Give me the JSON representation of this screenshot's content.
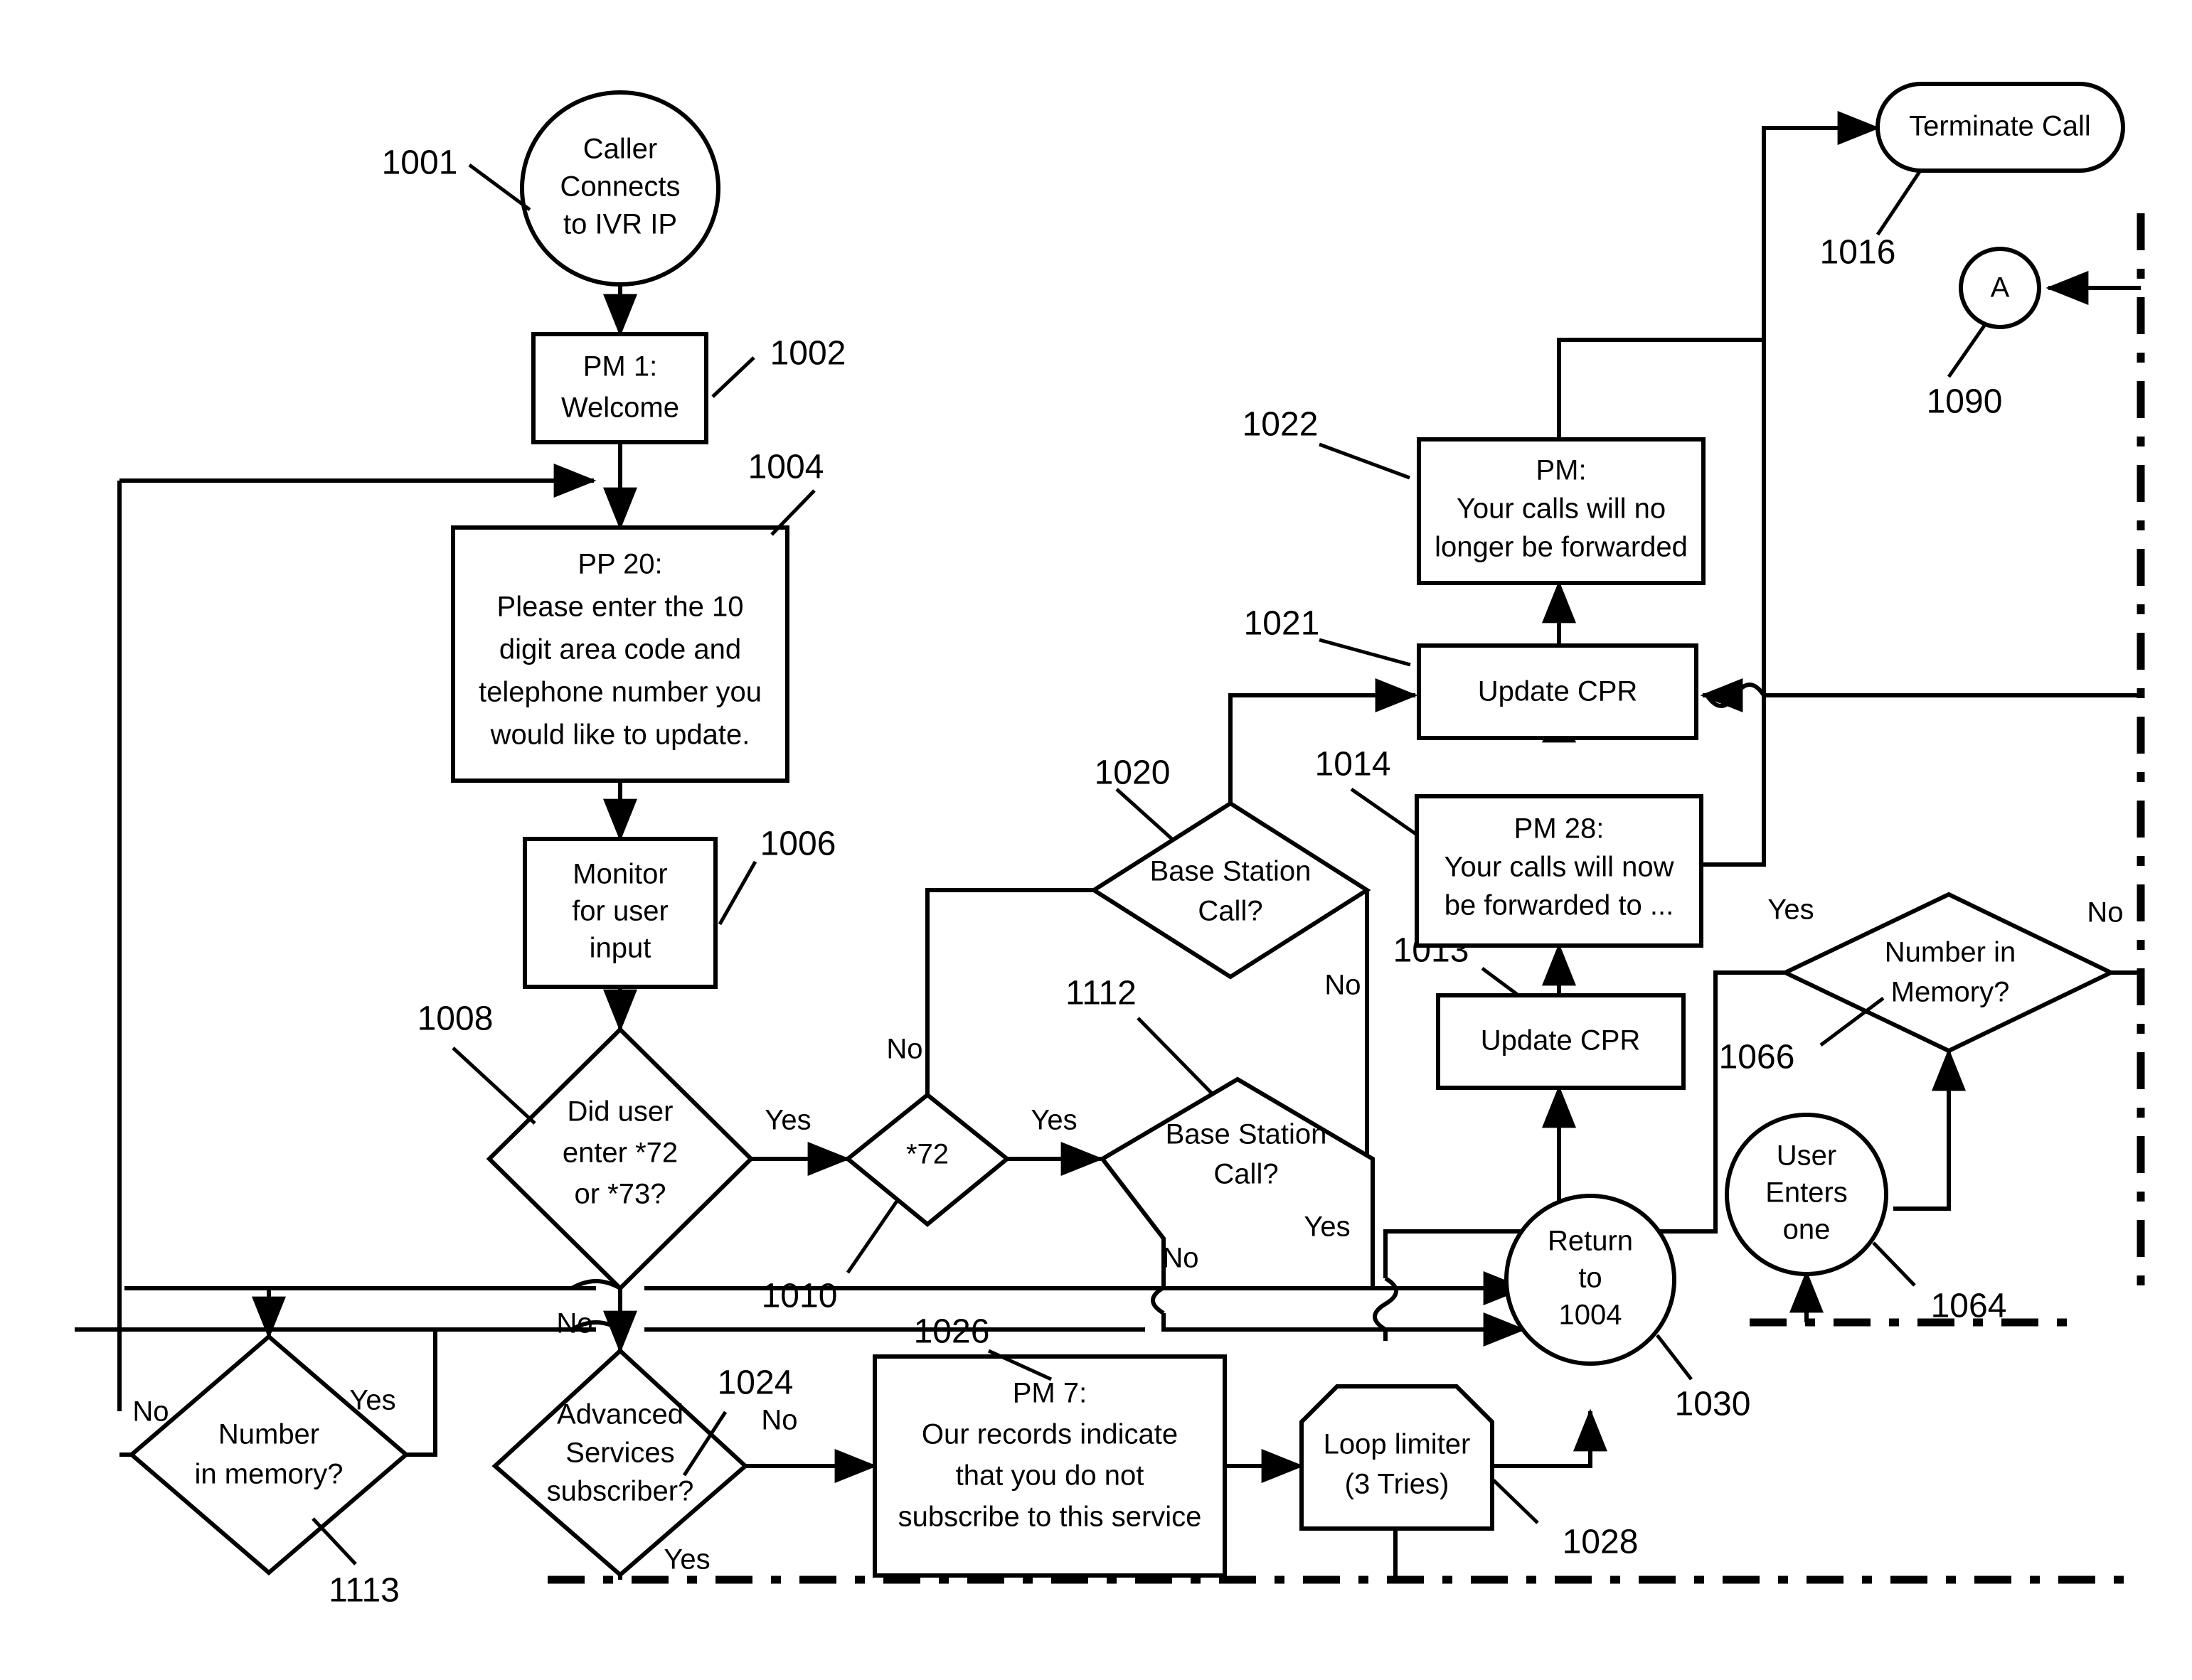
{
  "figure": {
    "type": "patent-flowchart",
    "title": "IVR call-forwarding update flowchart",
    "background": "#ffffff",
    "line_color": "#000000"
  },
  "nodes": {
    "n1001": {
      "ref": "1001",
      "shape": "ellipse",
      "lines": [
        "Caller",
        "Connects",
        "to IVR IP"
      ]
    },
    "n1002": {
      "ref": "1002",
      "shape": "rect",
      "lines": [
        "PM 1:",
        "Welcome"
      ]
    },
    "n1004": {
      "ref": "1004",
      "shape": "rect",
      "lines": [
        "PP 20:",
        "Please enter the 10",
        "digit area code and",
        "telephone number you",
        "would like to update."
      ]
    },
    "n1006": {
      "ref": "1006",
      "shape": "rect",
      "lines": [
        "Monitor",
        "for user",
        "input"
      ]
    },
    "n1008": {
      "ref": "1008",
      "shape": "diamond",
      "lines": [
        "Did user",
        "enter *72",
        "or *73?"
      ]
    },
    "n1010": {
      "ref": "1010",
      "shape": "diamond",
      "lines": [
        "*72"
      ]
    },
    "n1112": {
      "ref": "1112",
      "shape": "diamond",
      "lines": [
        "Base Station",
        "Call?"
      ]
    },
    "n1020": {
      "ref": "1020",
      "shape": "diamond",
      "lines": [
        "Base Station",
        "Call?"
      ]
    },
    "n1013": {
      "ref": "1013",
      "shape": "rect",
      "lines": [
        "Update CPR"
      ]
    },
    "n1014": {
      "ref": "1014",
      "shape": "rect",
      "lines": [
        "PM 28:",
        "Your calls will now",
        "be forwarded to ..."
      ]
    },
    "n1021": {
      "ref": "1021",
      "shape": "rect",
      "lines": [
        "Update CPR"
      ]
    },
    "n1022": {
      "ref": "1022",
      "shape": "rect",
      "lines": [
        "PM:",
        "Your calls will no",
        "longer be forwarded"
      ]
    },
    "n1016": {
      "ref": "1016",
      "shape": "stadium",
      "lines": [
        "Terminate Call"
      ]
    },
    "n1090": {
      "ref": "1090",
      "shape": "circle",
      "lines": [
        "A"
      ]
    },
    "n1030": {
      "ref": "1030",
      "shape": "ellipse",
      "lines": [
        "Return",
        "to",
        "1004"
      ]
    },
    "n1113": {
      "ref": "1113",
      "shape": "diamond",
      "lines": [
        "Number",
        "in memory?"
      ]
    },
    "n1024": {
      "ref": "1024",
      "shape": "diamond",
      "lines": [
        "Advanced",
        "Services",
        "subscriber?"
      ]
    },
    "n1026": {
      "ref": "1026",
      "shape": "rect",
      "lines": [
        "PM 7:",
        "Our records indicate",
        "that you do not",
        "subscribe to this service"
      ]
    },
    "n1028": {
      "ref": "1028",
      "shape": "octagon",
      "lines": [
        "Loop limiter",
        "(3 Tries)"
      ]
    },
    "n1066": {
      "ref": "1066",
      "shape": "diamond",
      "lines": [
        "Number in",
        "Memory?"
      ]
    },
    "n1064": {
      "ref": "1064",
      "shape": "circle",
      "lines": [
        "User",
        "Enters",
        "one"
      ]
    }
  },
  "edge_labels": {
    "e1008_yes": "Yes",
    "e1008_no": "No",
    "e1010_yes": "Yes",
    "e1010_no": "No",
    "e1112_yes": "Yes",
    "e1112_no": "No",
    "e1020_no": "No",
    "e1113_yes": "Yes",
    "e1113_no": "No",
    "e1024_no": "No",
    "e1024_yes": "Yes",
    "e1066_yes": "Yes",
    "e1066_no": "No"
  },
  "refs": {
    "r1001": "1001",
    "r1002": "1002",
    "r1004": "1004",
    "r1006": "1006",
    "r1008": "1008",
    "r1010": "1010",
    "r1112": "1112",
    "r1020": "1020",
    "r1013": "1013",
    "r1014": "1014",
    "r1021": "1021",
    "r1022": "1022",
    "r1016": "1016",
    "r1090": "1090",
    "r1030": "1030",
    "r1113": "1113",
    "r1024": "1024",
    "r1026": "1026",
    "r1028": "1028",
    "r1066": "1066",
    "r1064": "1064"
  }
}
